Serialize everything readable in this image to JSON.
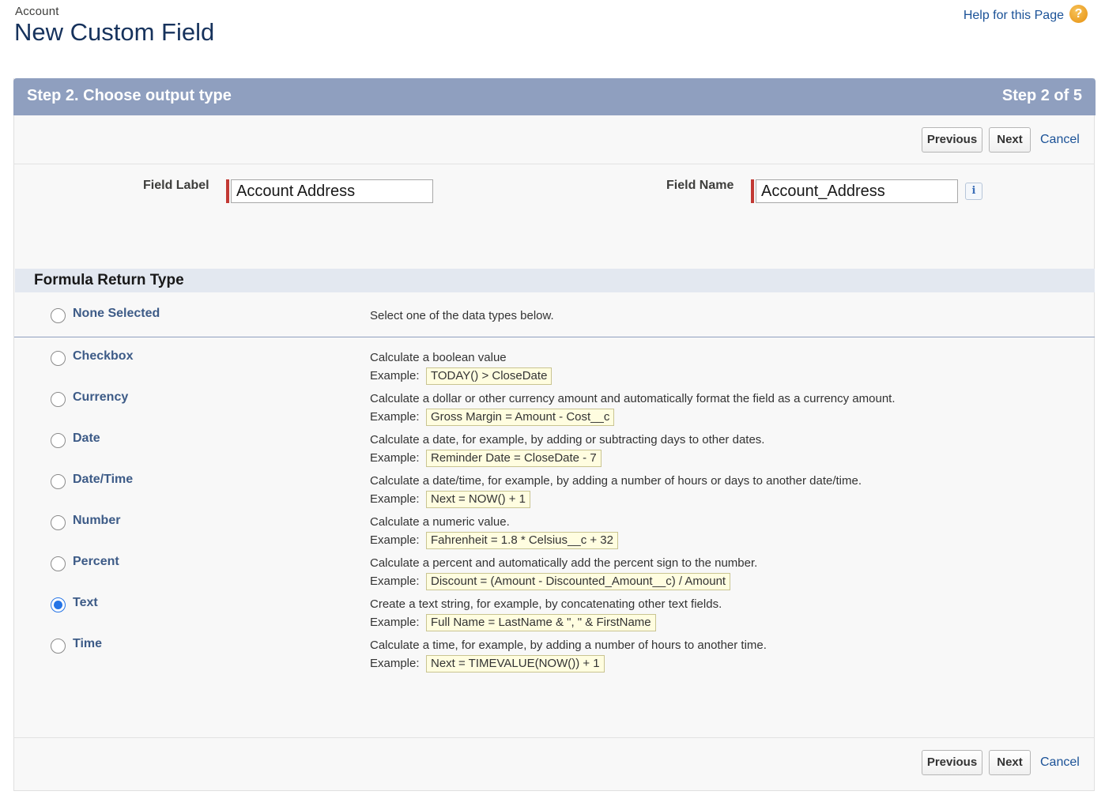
{
  "header": {
    "breadcrumb": "Account",
    "title": "New Custom Field",
    "help_link": "Help for this Page",
    "help_icon": "?"
  },
  "wizard": {
    "step_title": "Step 2. Choose output type",
    "step_count": "Step 2 of 5"
  },
  "buttons": {
    "previous": "Previous",
    "next": "Next",
    "cancel": "Cancel"
  },
  "fields": {
    "field_label_caption": "Field Label",
    "field_label_value": "Account Address",
    "field_name_caption": "Field Name",
    "field_name_value": "Account_Address",
    "info_icon": "i"
  },
  "formula_return_type": {
    "title": "Formula Return Type",
    "none_option": {
      "label": "None Selected",
      "description": "Select one of the data types below."
    },
    "example_label": "Example:",
    "selected": "Text",
    "options": [
      {
        "label": "Checkbox",
        "description": "Calculate a boolean value",
        "example": "TODAY() > CloseDate"
      },
      {
        "label": "Currency",
        "description": "Calculate a dollar or other currency amount and automatically format the field as a currency amount.",
        "example": "Gross Margin = Amount - Cost__c"
      },
      {
        "label": "Date",
        "description": "Calculate a date, for example, by adding or subtracting days to other dates.",
        "example": "Reminder Date = CloseDate - 7"
      },
      {
        "label": "Date/Time",
        "description": "Calculate a date/time, for example, by adding a number of hours or days to another date/time.",
        "example": "Next = NOW() + 1"
      },
      {
        "label": "Number",
        "description": "Calculate a numeric value.",
        "example": "Fahrenheit = 1.8 * Celsius__c + 32"
      },
      {
        "label": "Percent",
        "description": "Calculate a percent and automatically add the percent sign to the number.",
        "example": "Discount = (Amount - Discounted_Amount__c) / Amount"
      },
      {
        "label": "Text",
        "description": "Create a text string, for example, by concatenating other text fields.",
        "example": "Full Name = LastName & \", \" & FirstName"
      },
      {
        "label": "Time",
        "description": "Calculate a time, for example, by adding a number of hours to another time.",
        "example": "Next = TIMEVALUE(NOW()) + 1"
      }
    ]
  }
}
